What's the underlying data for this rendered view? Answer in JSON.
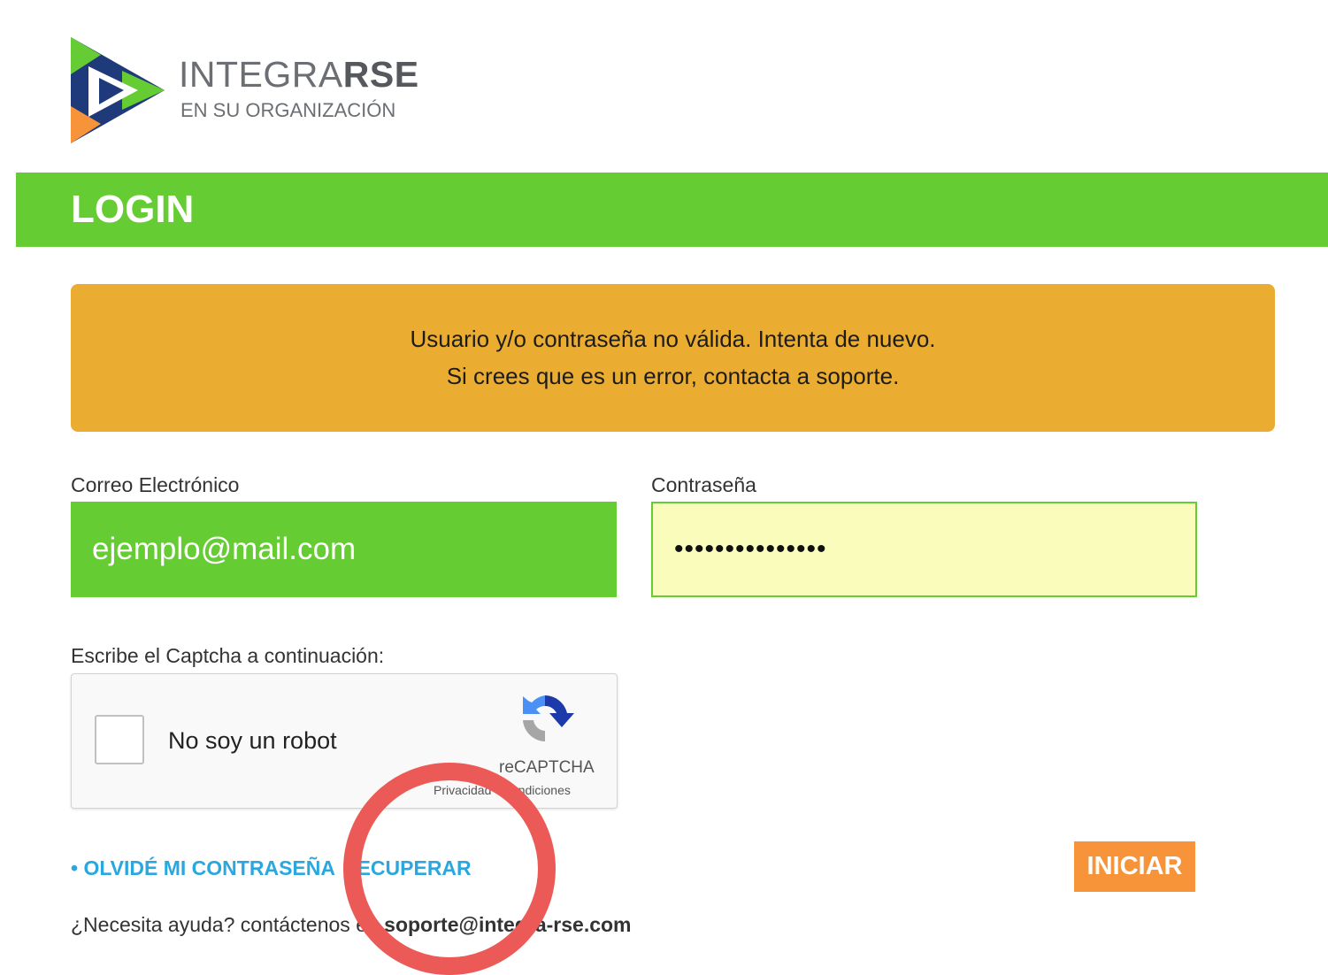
{
  "brand": {
    "name_light": "INTEGRA",
    "name_bold": "RSE",
    "tagline": "EN SU ORGANIZACIÓN",
    "colors": {
      "dark_blue": "#1f3a7a",
      "green": "#66cc33",
      "orange": "#f7943a"
    }
  },
  "page": {
    "title": "LOGIN"
  },
  "alert": {
    "line1": "Usuario y/o contraseña no válida. Intenta de nuevo.",
    "line2": "Si crees que es un error, contacta a soporte.",
    "color": "#ebac32"
  },
  "form": {
    "email_label": "Correo Electrónico",
    "email_value": "ejemplo@mail.com",
    "password_label": "Contraseña",
    "password_value": "•••••••••••••••",
    "captcha_label": "Escribe el Captcha a continuación:"
  },
  "captcha": {
    "checkbox_label": "No soy un robot",
    "brand": "reCAPTCHA",
    "links": "Privacidad - Condiciones"
  },
  "links": {
    "forgot_prefix": "• OLVIDÉ MI CONTRASEÑA",
    "recover": "RECUPERAR"
  },
  "submit": {
    "label": "INICIAR"
  },
  "help": {
    "text": "¿Necesita ayuda? contáctenos en",
    "email": "soporte@integra-rse.com"
  },
  "annotation": {
    "shape": "circle",
    "color": "#ec5a57"
  }
}
